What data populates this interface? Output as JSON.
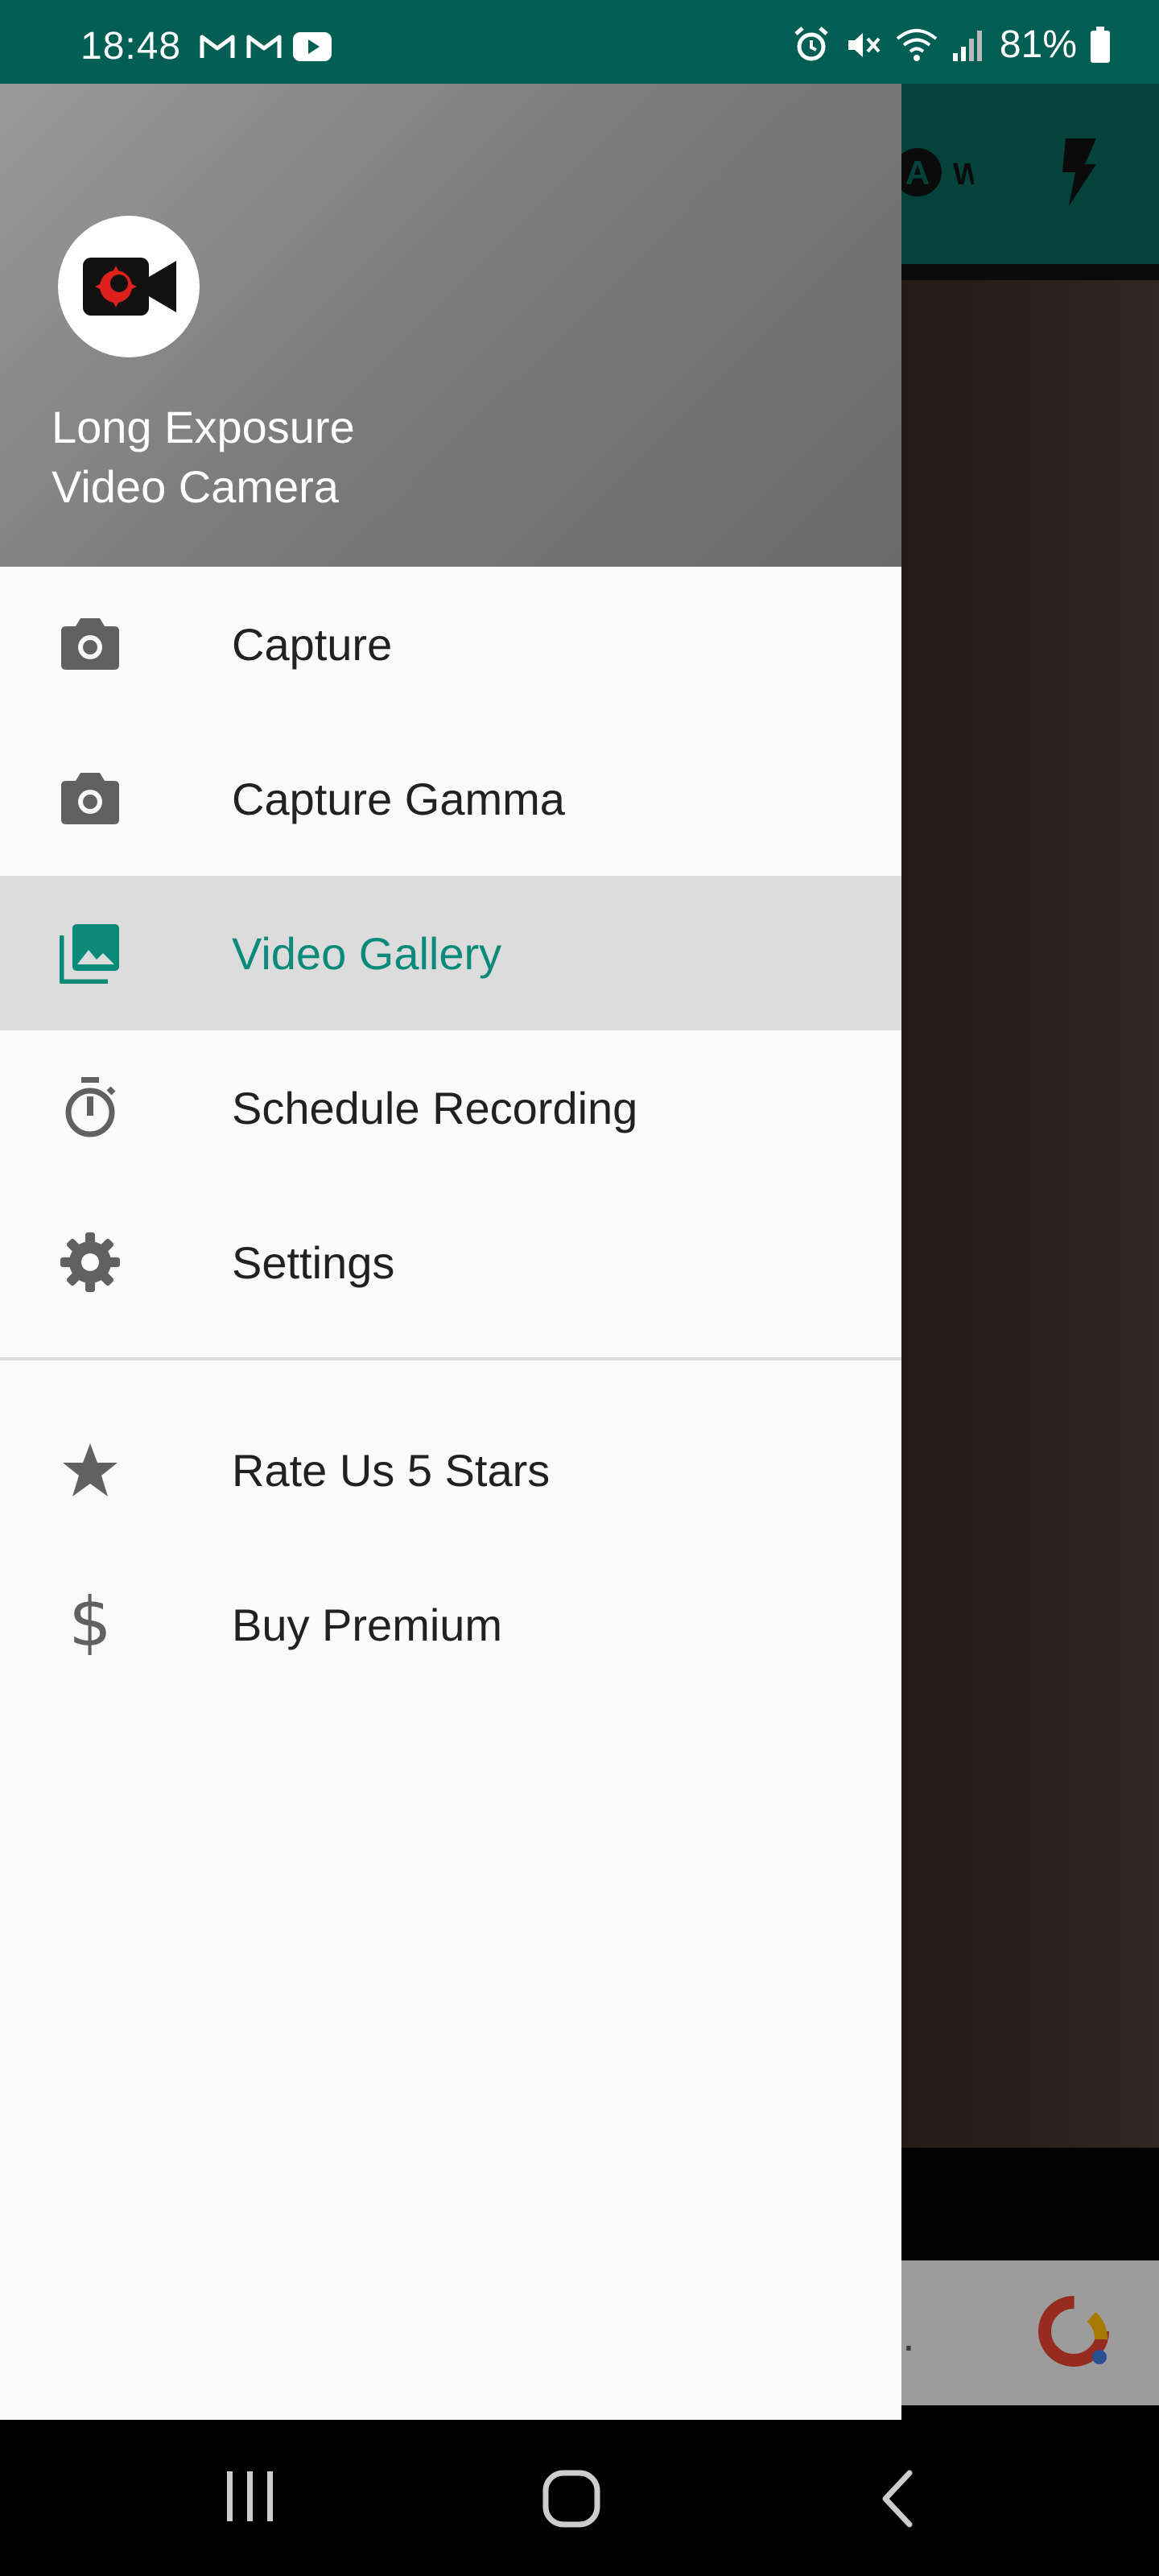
{
  "status_bar": {
    "time": "18:48",
    "battery": "81%",
    "notification_icons": [
      "gmail-icon",
      "gmail-icon",
      "youtube-icon"
    ],
    "system_icons": [
      "alarm-icon",
      "mute-icon",
      "wifi-icon",
      "signal-icon",
      "battery-icon"
    ]
  },
  "background_app": {
    "ad_text": "d.",
    "toolbar_icons": [
      "raw-icon",
      "flash-icon"
    ]
  },
  "drawer": {
    "header": {
      "app_name_line1": "Long Exposure",
      "app_name_line2": "Video Camera",
      "logo_icon": "video-camera-icon"
    },
    "items": [
      {
        "label": "Capture",
        "icon": "camera-icon",
        "active": false
      },
      {
        "label": "Capture Gamma",
        "icon": "camera-icon",
        "active": false
      },
      {
        "label": "Video Gallery",
        "icon": "photo-library-icon",
        "active": true
      },
      {
        "label": "Schedule Recording",
        "icon": "timer-icon",
        "active": false
      },
      {
        "label": "Settings",
        "icon": "gear-icon",
        "active": false
      }
    ],
    "secondary_items": [
      {
        "label": "Rate Us 5 Stars",
        "icon": "star-icon"
      },
      {
        "label": "Buy Premium",
        "icon": "dollar-icon"
      }
    ]
  },
  "colors": {
    "status_bar": "#035f53",
    "accent": "#0b8a7a",
    "icon_gray": "#616161",
    "active_bg": "#dcdcdc"
  },
  "nav_bar": {
    "buttons": [
      "recent-apps",
      "home",
      "back"
    ]
  }
}
